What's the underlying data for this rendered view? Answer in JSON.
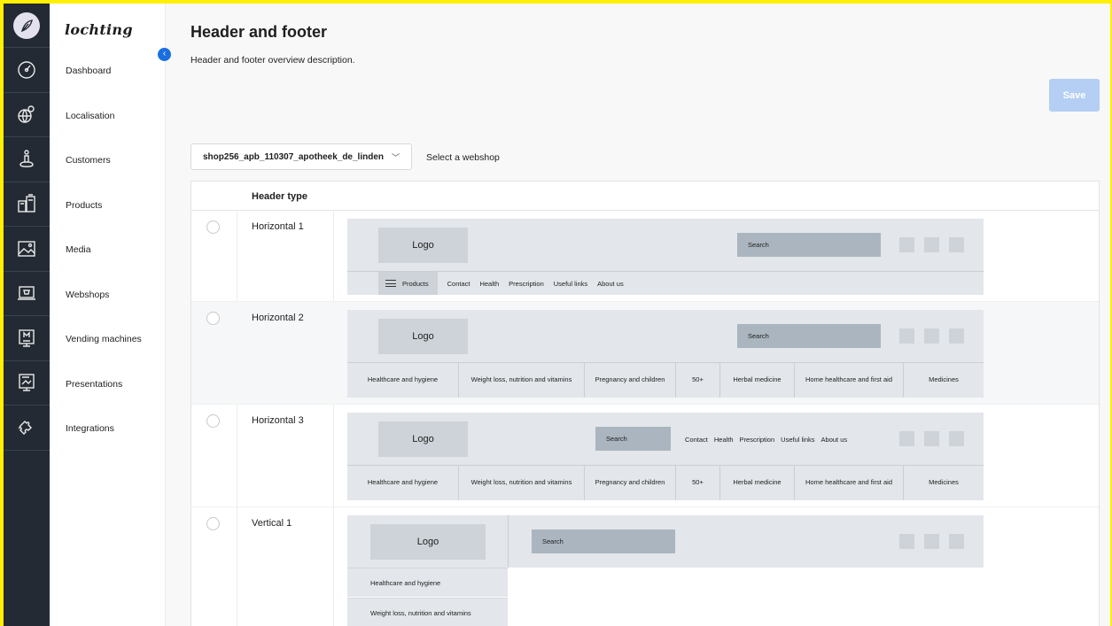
{
  "app": {
    "brand": "lochting"
  },
  "rail_icons": [
    "logo-icon",
    "dashboard-icon",
    "globe-icon",
    "customer-icon",
    "products-icon",
    "media-icon",
    "webshop-icon",
    "vending-machine-icon",
    "presentation-icon",
    "puzzle-icon"
  ],
  "sidebar": {
    "items": [
      {
        "label": "Dashboard"
      },
      {
        "label": "Localisation"
      },
      {
        "label": "Customers"
      },
      {
        "label": "Products"
      },
      {
        "label": "Media"
      },
      {
        "label": "Webshops"
      },
      {
        "label": "Vending machines"
      },
      {
        "label": "Presentations"
      },
      {
        "label": "Integrations"
      }
    ]
  },
  "page": {
    "title": "Header and footer",
    "description": "Header and footer overview description.",
    "save_label": "Save"
  },
  "webshop_select": {
    "value": "shop256_apb_110307_apotheek_de_linden",
    "hint": "Select a webshop"
  },
  "table": {
    "column_header": "Header type",
    "rows": [
      {
        "label": "Horizontal 1"
      },
      {
        "label": "Horizontal 2"
      },
      {
        "label": "Horizontal 3"
      },
      {
        "label": "Vertical 1"
      }
    ]
  },
  "preview": {
    "logo": "Logo",
    "search": "Search",
    "products": "Products",
    "nav_links": [
      "Contact",
      "Health",
      "Prescription",
      "Useful links",
      "About us"
    ],
    "categories": [
      "Healthcare and hygiene",
      "Weight loss, nutrition and vitamins",
      "Pregnancy and children",
      "50+",
      "Herbal medicine",
      "Home healthcare and first aid",
      "Medicines"
    ]
  },
  "colors": {
    "rail_bg": "#232a33",
    "accent": "#1a6fe0",
    "save_disabled": "#b4cff3",
    "preview_bg": "#e3e6ea",
    "border_yellow": "#ffef00"
  }
}
